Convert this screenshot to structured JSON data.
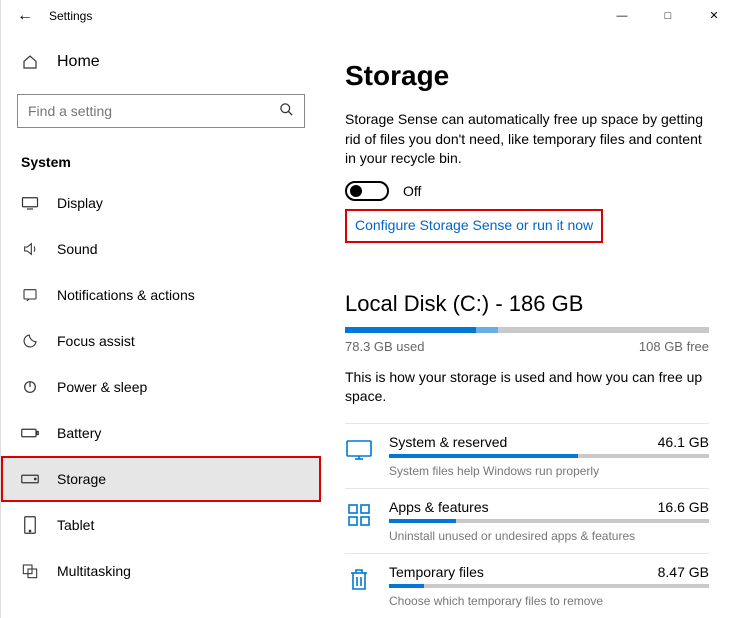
{
  "window": {
    "title": "Settings"
  },
  "sidebar": {
    "home": "Home",
    "search_placeholder": "Find a setting",
    "section": "System",
    "items": [
      {
        "label": "Display"
      },
      {
        "label": "Sound"
      },
      {
        "label": "Notifications & actions"
      },
      {
        "label": "Focus assist"
      },
      {
        "label": "Power & sleep"
      },
      {
        "label": "Battery"
      },
      {
        "label": "Storage"
      },
      {
        "label": "Tablet"
      },
      {
        "label": "Multitasking"
      }
    ]
  },
  "content": {
    "heading": "Storage",
    "description": "Storage Sense can automatically free up space by getting rid of files you don't need, like temporary files and content in your recycle bin.",
    "toggle_state": "Off",
    "configure_link": "Configure Storage Sense or run it now",
    "disk": {
      "title": "Local Disk (C:) - 186 GB",
      "used_label": "78.3 GB used",
      "free_label": "108 GB free",
      "used_pct": 42,
      "desc": "This is how your storage is used and how you can free up space."
    },
    "categories": [
      {
        "name": "System & reserved",
        "size": "46.1 GB",
        "sub": "System files help Windows run properly",
        "pct": 59
      },
      {
        "name": "Apps & features",
        "size": "16.6 GB",
        "sub": "Uninstall unused or undesired apps & features",
        "pct": 21
      },
      {
        "name": "Temporary files",
        "size": "8.47 GB",
        "sub": "Choose which temporary files to remove",
        "pct": 11
      }
    ]
  }
}
